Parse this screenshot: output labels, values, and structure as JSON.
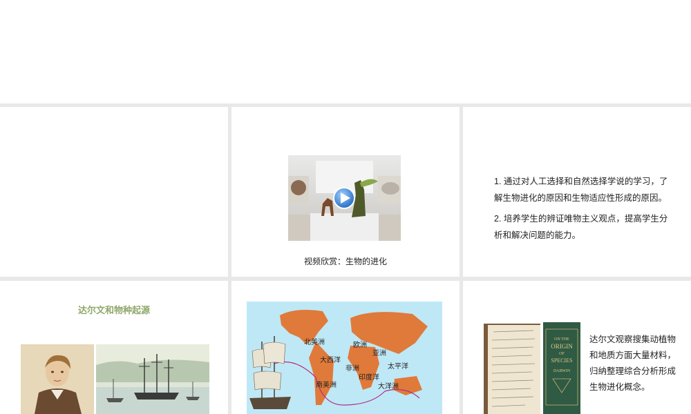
{
  "slide2": {
    "caption": "视频欣赏：生物的进化"
  },
  "slide3": {
    "objectives": [
      "1. 通过对人工选择和自然选择学说的学习，了解生物进化的原因和生物适应性形成的原因。",
      "2. 培养学生的辨证唯物主义观点，提高学生分析和解决问题的能力。"
    ]
  },
  "slide4": {
    "title": "达尔文和物种起源"
  },
  "slide5": {
    "map_labels": {
      "north_america": "北美洲",
      "europe": "欧洲",
      "asia": "亚洲",
      "atlantic": "大西洋",
      "africa": "非洲",
      "pacific": "太平洋",
      "indian_ocean": "印度洋",
      "south_america": "南美洲",
      "oceania": "大洋洲"
    }
  },
  "slide6": {
    "text": "达尔文观察搜集动植物和地质方面大量材料，归纳整理综合分析形成生物进化概念。",
    "book_title_lines": [
      "ON THE",
      "ORIGIN",
      "OF",
      "SPECIES",
      "DARWIN"
    ]
  },
  "colors": {
    "title_green": "#8fa86a",
    "play_blue": "#2f80d0",
    "map_land": "#e07a3a",
    "map_sea": "#bfe8f6"
  }
}
